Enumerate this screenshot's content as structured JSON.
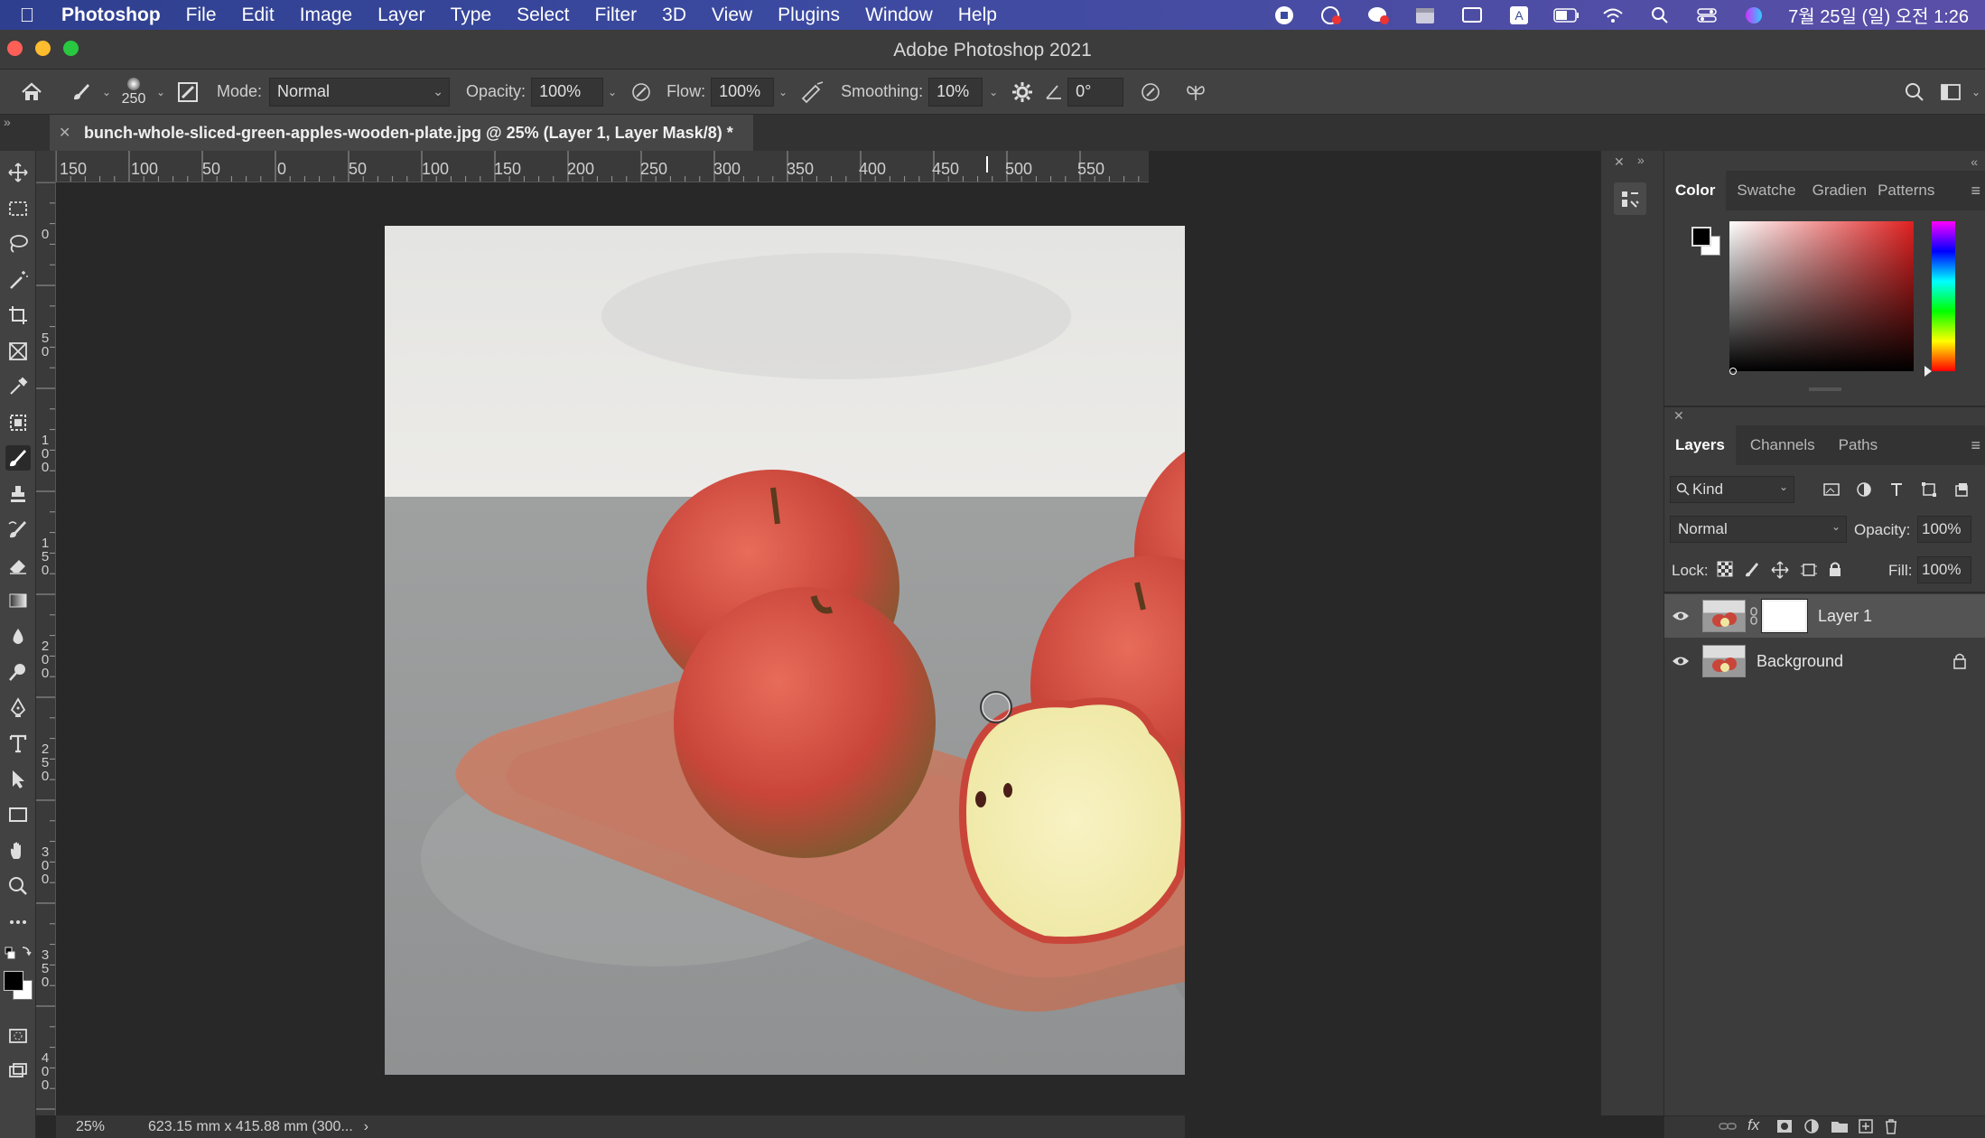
{
  "menubar": {
    "app_name": "Photoshop",
    "items": [
      "File",
      "Edit",
      "Image",
      "Layer",
      "Type",
      "Select",
      "Filter",
      "3D",
      "View",
      "Plugins",
      "Window",
      "Help"
    ],
    "clock": "7월 25일 (일) 오전 1:26"
  },
  "window": {
    "title": "Adobe Photoshop 2021"
  },
  "options": {
    "brush_size": "250",
    "mode_label": "Mode:",
    "mode_value": "Normal",
    "opacity_label": "Opacity:",
    "opacity_value": "100%",
    "flow_label": "Flow:",
    "flow_value": "100%",
    "smoothing_label": "Smoothing:",
    "smoothing_value": "10%",
    "angle_value": "0°"
  },
  "document": {
    "tab_title": "bunch-whole-sliced-green-apples-wooden-plate.jpg @ 25% (Layer 1, Layer Mask/8) *"
  },
  "ruler": {
    "h_labels": [
      "150",
      "100",
      "50",
      "0",
      "50",
      "100",
      "150",
      "200",
      "250",
      "300",
      "350",
      "400",
      "450",
      "500",
      "550"
    ],
    "v_labels": [
      "0",
      "5\n0",
      "1\n0\n0",
      "1\n5\n0",
      "2\n0\n0",
      "2\n5\n0",
      "3\n0\n0",
      "3\n5\n0",
      "4\n0\n0"
    ]
  },
  "status": {
    "zoom": "25%",
    "doc_info": "623.15 mm x 415.88 mm (300...",
    "arrow": "›"
  },
  "color_panel": {
    "tabs": [
      "Color",
      "Swatche",
      "Gradien",
      "Patterns"
    ],
    "accent": "#e02020"
  },
  "layers_panel": {
    "tabs": [
      "Layers",
      "Channels",
      "Paths"
    ],
    "filter_label": "Kind",
    "blend_mode": "Normal",
    "opacity_label": "Opacity:",
    "opacity_value": "100%",
    "lock_label": "Lock:",
    "fill_label": "Fill:",
    "fill_value": "100%",
    "layers": [
      {
        "name": "Layer 1",
        "selected": true
      },
      {
        "name": "Background",
        "selected": false
      }
    ]
  }
}
